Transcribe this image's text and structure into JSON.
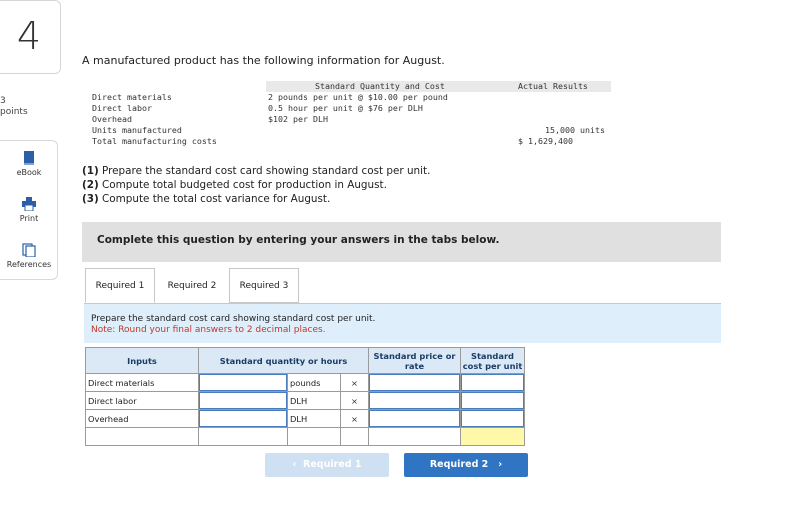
{
  "question": {
    "number": "4",
    "points_value": "3",
    "points_label": "points"
  },
  "tools": [
    {
      "label": "eBook",
      "icon": "ebook-icon"
    },
    {
      "label": "Print",
      "icon": "print-icon"
    },
    {
      "label": "References",
      "icon": "references-icon"
    }
  ],
  "prompt": {
    "intro": "A manufactured product has the following information for August.",
    "table_header_standard": "Standard Quantity and Cost",
    "table_header_actual": "Actual Results",
    "rows": [
      {
        "label": "Direct materials",
        "standard": "2 pounds per unit @ $10.00 per pound",
        "actual": ""
      },
      {
        "label": "Direct labor",
        "standard": "0.5 hour per unit @ $76 per DLH",
        "actual": ""
      },
      {
        "label": "Overhead",
        "standard": "$102 per DLH",
        "actual": ""
      },
      {
        "label": "Units manufactured",
        "standard": "",
        "actual": "15,000 units"
      },
      {
        "label": "Total manufacturing costs",
        "standard": "",
        "actual": "$ 1,629,400"
      }
    ],
    "requirements": [
      {
        "num": "(1)",
        "text": " Prepare the standard cost card showing standard cost per unit."
      },
      {
        "num": "(2)",
        "text": " Compute total budgeted cost for production in August."
      },
      {
        "num": "(3)",
        "text": " Compute the total cost variance for August."
      }
    ]
  },
  "instruction": "Complete this question by entering your answers in the tabs below.",
  "tabs": [
    "Required 1",
    "Required 2",
    "Required 3"
  ],
  "active_tab": "Required 1",
  "tab_content": {
    "line1": "Prepare the standard cost card showing standard cost per unit.",
    "line2": "Note: Round your final answers to 2 decimal places."
  },
  "card": {
    "headers": [
      "Inputs",
      "Standard quantity or hours",
      "Standard price or rate",
      "Standard cost per unit"
    ],
    "rows": [
      {
        "label": "Direct materials",
        "unit": "pounds",
        "op": "×"
      },
      {
        "label": "Direct labor",
        "unit": "DLH",
        "op": "×"
      },
      {
        "label": "Overhead",
        "unit": "DLH",
        "op": "×"
      }
    ]
  },
  "nav": {
    "prev_label": "Required 1",
    "next_label": "Required 2"
  },
  "colors": {
    "accent": "#2f75c4",
    "note_red": "#c0392b",
    "header_blue": "#dbe9f7",
    "total_yellow": "#fff8a8"
  }
}
